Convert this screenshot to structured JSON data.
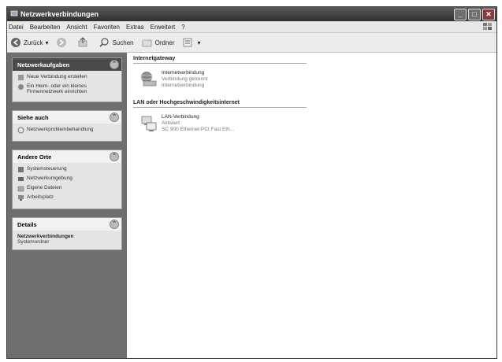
{
  "window": {
    "title": "Netzwerkverbindungen"
  },
  "menu": [
    "Datei",
    "Bearbeiten",
    "Ansicht",
    "Favoriten",
    "Extras",
    "Erweitert",
    "?"
  ],
  "toolbar": {
    "back": "Zurück",
    "search": "Suchen",
    "folders": "Ordner"
  },
  "sidebar": {
    "network_tasks": {
      "title": "Netzwerkaufgaben",
      "items": [
        "Neue Verbindung erstellen",
        "Ein Heim- oder ein kleines Firmennetzwerk einrichten"
      ]
    },
    "see_also": {
      "title": "Siehe auch",
      "items": [
        "Netzwerkproblembehandlung"
      ]
    },
    "other_places": {
      "title": "Andere Orte",
      "items": [
        "Systemsteuerung",
        "Netzwerkumgebung",
        "Eigene Dateien",
        "Arbeitsplatz"
      ]
    },
    "details": {
      "title": "Details",
      "name": "Netzwerkverbindungen",
      "type": "Systemordner"
    }
  },
  "main": {
    "internet_gateway": {
      "heading": "Internetgateway",
      "name": "Internetverbindung",
      "line1": "Verbindung getrennt",
      "line2": "Internetverbindung"
    },
    "lan": {
      "heading": "LAN oder Hochgeschwindigkeitsinternet",
      "name": "LAN-Verbindung",
      "line1": "Aktiviert",
      "line2": "SC 900 Ethernet PCI Fast Eth..."
    }
  }
}
